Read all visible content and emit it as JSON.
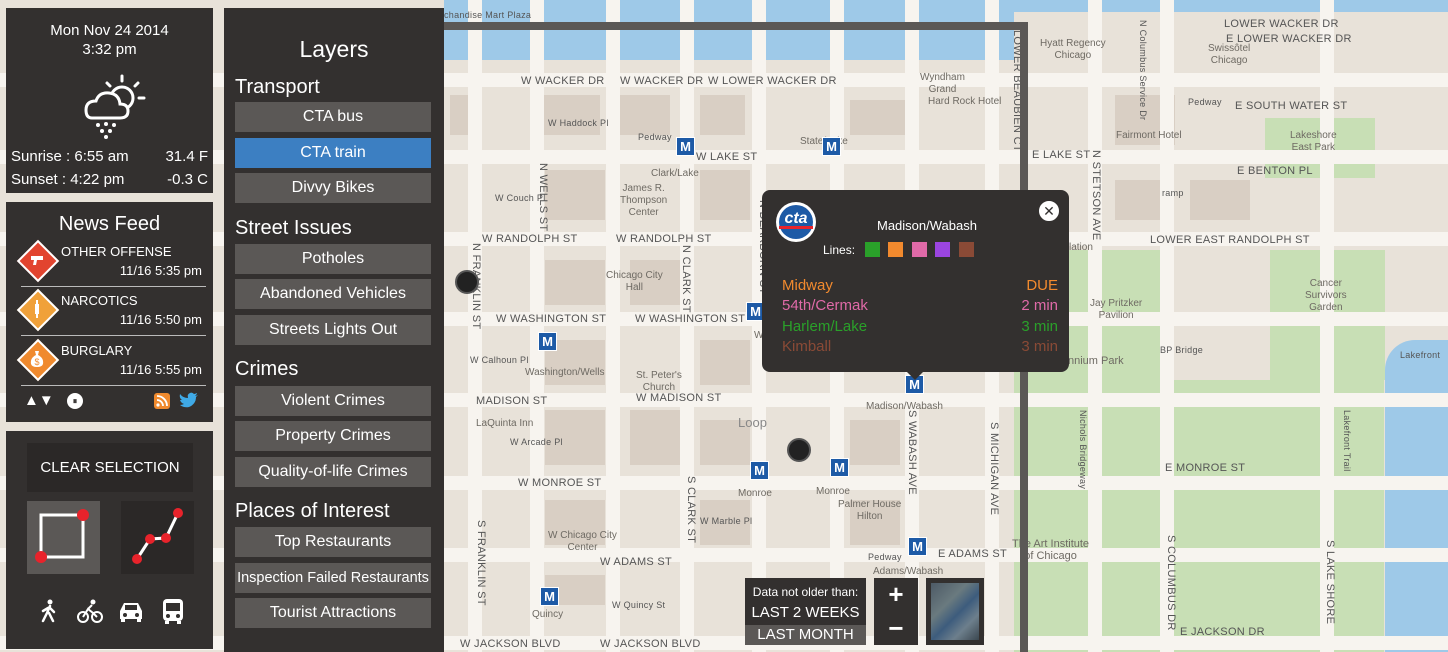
{
  "map": {
    "streets": {
      "wacker_upper": "W WACKER DR",
      "wacker_upper2": "W WACKER DR",
      "lower_wacker": "W LOWER WACKER DR",
      "lower_wacker_e": "LOWER WACKER DR",
      "lower_wacker_e2": "E LOWER WACKER DR",
      "lake": "W LAKE ST",
      "e_lake": "E LAKE ST",
      "randolph": "W RANDOLPH ST",
      "randolph2": "W RANDOLPH ST",
      "lower_east_randolph": "LOWER EAST RANDOLPH ST",
      "washington": "W WASHINGTON ST",
      "washington2": "W WASHINGTON ST",
      "madison": "MADISON ST",
      "madison2": "W MADISON ST",
      "monroe": "W MONROE ST",
      "e_monroe": "E MONROE ST",
      "adams": "E ADAMS ST",
      "adams_w": "W ADAMS ST",
      "jackson": "W JACKSON BLVD",
      "jackson2": "W JACKSON BLVD",
      "e_jackson": "E JACKSON DR",
      "s_water": "E SOUTH WATER ST",
      "benton": "E BENTON PL",
      "haddock": "W Haddock Pl",
      "couch": "W Couch Pl",
      "calhoun": "W Calhoun Pl",
      "arcade": "W Arcade Pl",
      "marble": "W Marble Pl",
      "quincy": "W Quincy St",
      "wells": "N WELLS ST",
      "franklin": "N FRANKLIN ST",
      "s_franklin": "S FRANKLIN ST",
      "clark": "N CLARK ST",
      "s_clark": "S CLARK ST",
      "dearborn": "N DEARBORN ST",
      "s_wabash": "S WABASH AVE",
      "s_michigan": "S MICHIGAN AVE",
      "lower_beaubien": "LOWER BEAUBIEN CT",
      "stetson": "N STETSON AVE",
      "columbus_service": "N Columbus Service Dr",
      "s_columbus": "S COLUMBUS DR",
      "s_lake_shore": "S LAKE SHORE",
      "nichols": "Nichols Bridgeway",
      "lakefront": "Lakefront Trail",
      "pedway1": "Pedway",
      "pedway2": "Pedway",
      "pedway3": "Pedway",
      "lakefront2": "Lakefront",
      "ramp": "ramp",
      "bp_bridge": "BP Bridge",
      "merchandise": "chandise Mart Plaza"
    },
    "pois": {
      "wyndham": "Wyndham\nGrand",
      "hyatt": "Hyatt Regency\nChicago",
      "swissotel": "Swissôtel\nChicago",
      "hard_rock": "Hard Rock Hotel",
      "fairmont": "Fairmont Hotel",
      "lakeshore_east": "Lakeshore\nEast Park",
      "state_lake": "State/Lake",
      "clark_lake": "Clark/Lake",
      "thompson": "James R.\nThompson\nCenter",
      "city_hall": "Chicago City\nHall",
      "washington_wells": "Washington/Wells",
      "st_peters": "St. Peter's\nChurch",
      "washington_stn": "Washi",
      "la_quinta": "LaQuinta Inn",
      "loop": "Loop",
      "madison_wabash": "Madison/Wabash",
      "monroe1": "Monroe",
      "monroe2": "Monroe",
      "palmer": "Palmer House\nHilton",
      "chicago_city_center": "W Chicago City\nCenter",
      "adams_wabash": "Adams/Wabash",
      "art_institute": "The Art Institute\nof Chicago",
      "quincy": "Quincy",
      "jay_pritzker": "Jay Pritzker\nPavilion",
      "cancer_survivors": "Cancer\nSurvivors\nGarden",
      "millennium": "nnium Park",
      "lation": "lation"
    },
    "metro_glyph": "M"
  },
  "time_panel": {
    "date": "Mon Nov 24 2014",
    "time": "3:32 pm",
    "weather_icon": "partly-cloudy-snow-icon",
    "sunrise": "Sunrise : 6:55 am",
    "sunset": "Sunset : 4:22 pm",
    "temp_f": "31.4 F",
    "temp_c": "-0.3 C"
  },
  "news_feed": {
    "title": "News Feed",
    "items": [
      {
        "title": "OTHER OFFENSE",
        "time": "11/16 5:35 pm",
        "icon": "gun-icon"
      },
      {
        "title": "NARCOTICS",
        "time": "11/16 5:50 pm",
        "icon": "syringe-icon"
      },
      {
        "title": "BURGLARY",
        "time": "11/16 5:55 pm",
        "icon": "money-bag-icon"
      }
    ],
    "controls": {
      "updown": "▲▼",
      "pause": "⏸"
    }
  },
  "tools": {
    "clear_selection": "CLEAR SELECTION",
    "modes": [
      "walk-icon",
      "bike-icon",
      "car-icon",
      "bus-icon"
    ]
  },
  "layers": {
    "title": "Layers",
    "sections": [
      {
        "title": "Transport",
        "items": [
          "CTA bus",
          "CTA train",
          "Divvy Bikes"
        ]
      },
      {
        "title": "Street Issues",
        "items": [
          "Potholes",
          "Abandoned Vehicles",
          "Streets Lights Out"
        ]
      },
      {
        "title": "Crimes",
        "items": [
          "Violent Crimes",
          "Property Crimes",
          "Quality-of-life Crimes"
        ]
      },
      {
        "title": "Places of Interest",
        "items": [
          "Top Restaurants",
          "Inspection Failed Restaurants",
          "Tourist Attractions"
        ]
      }
    ]
  },
  "popup": {
    "logo": "cta",
    "station": "Madison/Wabash",
    "lines_label": "Lines:",
    "line_colors": [
      "#2aa02a",
      "#f28a2e",
      "#e06aa8",
      "#9b45e0",
      "#8a4a36"
    ],
    "arrivals": [
      {
        "dest": "Midway",
        "eta": "DUE",
        "color": "#f28a2e"
      },
      {
        "dest": "54th/Cermak",
        "eta": "2 min",
        "color": "#e06aa8"
      },
      {
        "dest": "Harlem/Lake",
        "eta": "3 min",
        "color": "#2aa02a"
      },
      {
        "dest": "Kimball",
        "eta": "3 min",
        "color": "#8a4a36"
      }
    ],
    "close": "✕"
  },
  "filter": {
    "label": "Data not older than:",
    "options": [
      "LAST 2 WEEKS",
      "LAST MONTH"
    ]
  },
  "zoom": {
    "in": "+",
    "out": "−"
  }
}
